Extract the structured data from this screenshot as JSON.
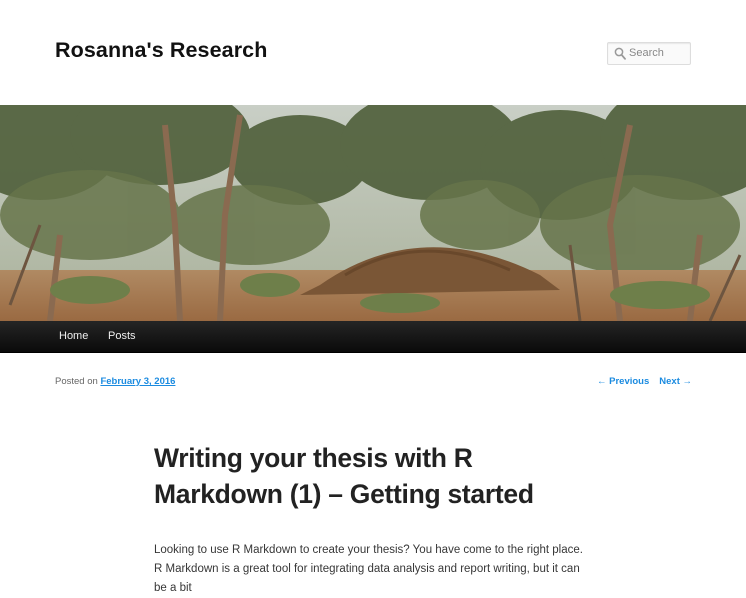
{
  "site": {
    "title": "Rosanna's Research",
    "search_placeholder": "Search",
    "search_icon": "magnifier-icon"
  },
  "nav": {
    "items": [
      {
        "label": "Home"
      },
      {
        "label": "Posts"
      }
    ]
  },
  "post": {
    "posted_on_label": "Posted on",
    "date": "February 3, 2016",
    "previous_label": "← Previous",
    "next_label": "Next →",
    "title": "Writing your thesis with R Markdown (1) – Getting started",
    "body_text": "Looking to use R Markdown to create your thesis? You have come to the right place. R Markdown is a great tool for integrating data analysis and report writing, but it can be a bit"
  },
  "colors": {
    "link": "#1b8be0",
    "nav_bg": "#111111",
    "title": "#111111"
  }
}
